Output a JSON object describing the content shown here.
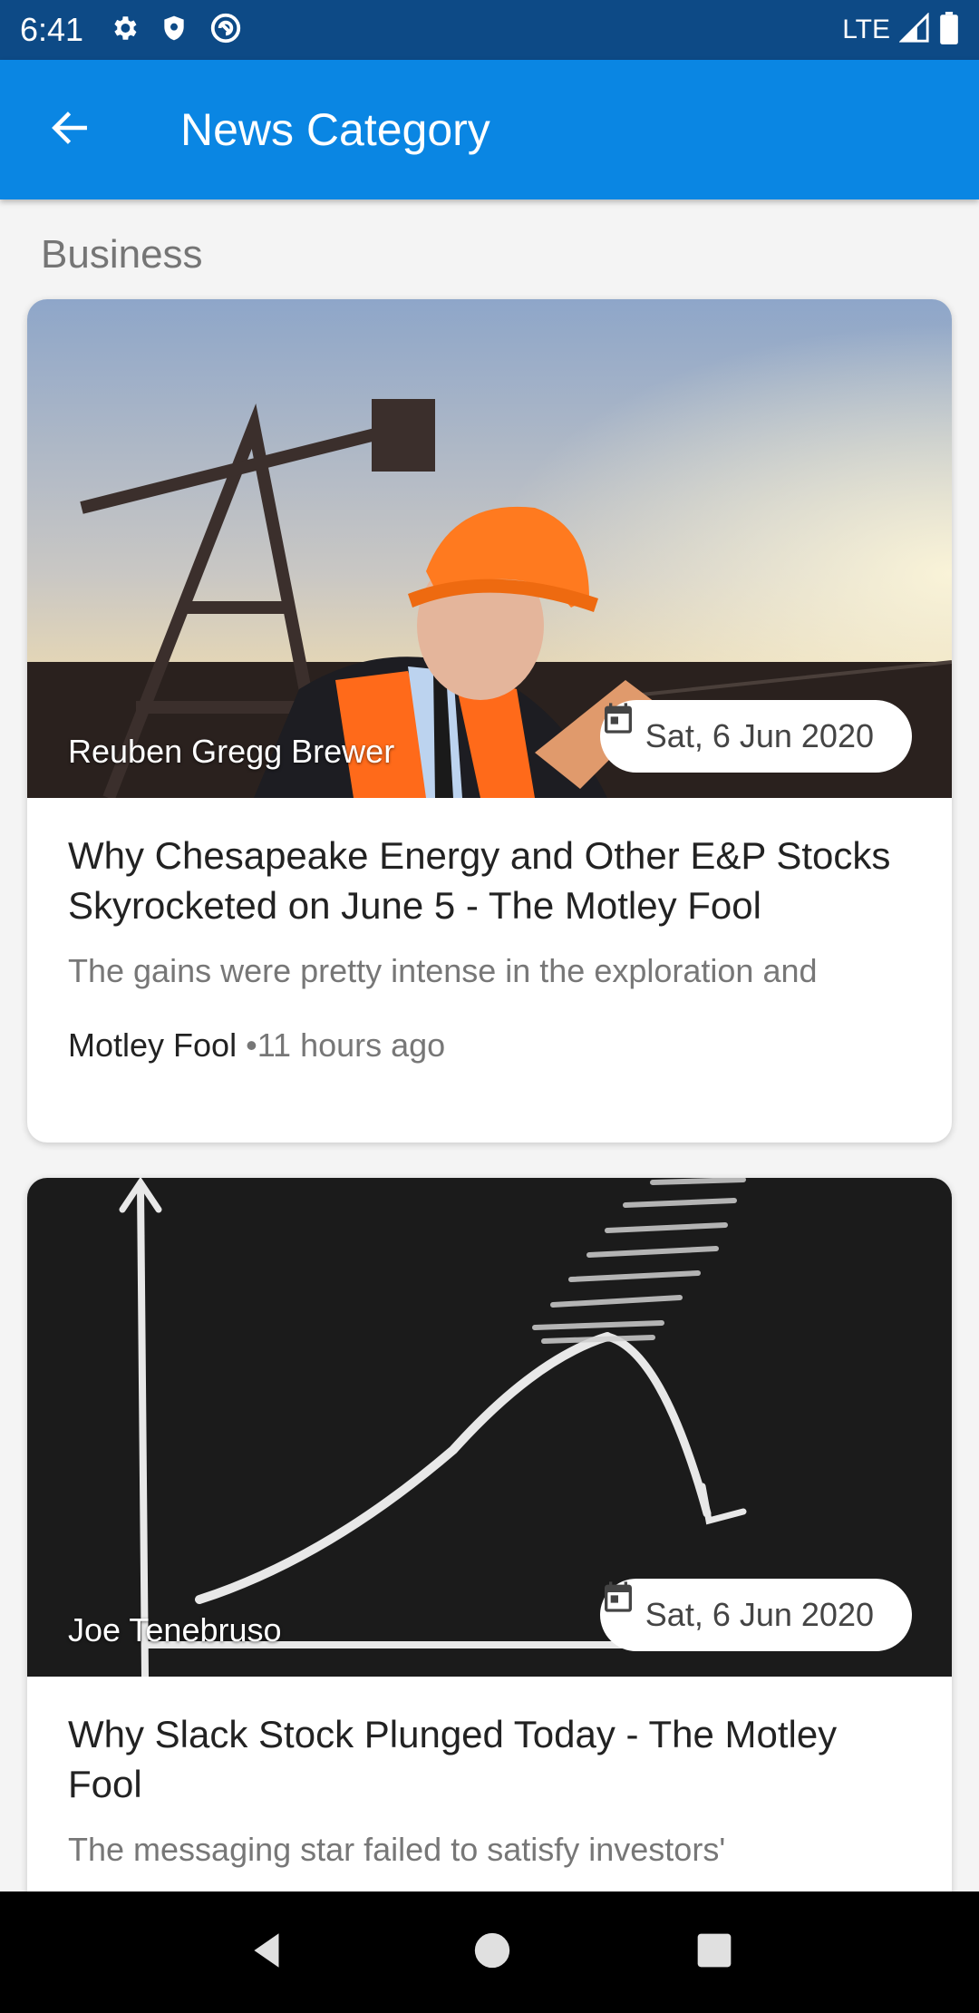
{
  "status_bar": {
    "time": "6:41",
    "network": "LTE",
    "icons": [
      "gear-icon",
      "shield-icon",
      "sync-icon",
      "signal-icon",
      "battery-icon"
    ]
  },
  "app_bar": {
    "title": "News Category",
    "back_icon": "arrow-back-icon",
    "color": "#0a86e3"
  },
  "section": {
    "label": "Business"
  },
  "articles": [
    {
      "author": "Reuben Gregg Brewer",
      "date": "Sat, 6 Jun 2020",
      "title": "Why Chesapeake Energy and Other E&P Stocks Skyrocketed on June 5 - The Motley Fool",
      "description": "The gains were pretty intense in the exploration and",
      "source": "Motley Fool",
      "time_ago": "•11 hours ago"
    },
    {
      "author": "Joe Tenebruso",
      "date": "Sat, 6 Jun 2020",
      "title": "Why Slack Stock Plunged Today - The Motley Fool",
      "description": "The messaging star failed to satisfy investors'"
    }
  ],
  "nav_bar": {
    "icons": [
      "back-triangle-icon",
      "home-circle-icon",
      "recents-square-icon"
    ]
  }
}
